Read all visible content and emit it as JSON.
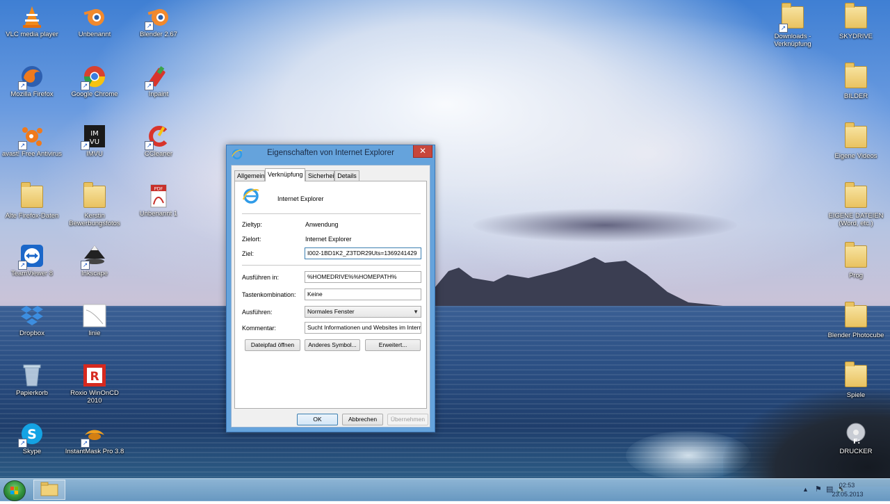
{
  "desktop": {
    "icons_left": [
      {
        "label": "VLC media player",
        "icon": "vlc-cone-icon"
      },
      {
        "label": "Unbenannt",
        "icon": "blender-icon"
      },
      {
        "label": "Blender 2.67",
        "icon": "blender-icon"
      },
      {
        "label": "Mozilla Firefox",
        "icon": "firefox-icon"
      },
      {
        "label": "Google Chrome",
        "icon": "chrome-icon"
      },
      {
        "label": "Inpaint",
        "icon": "inpaint-icon"
      },
      {
        "label": "avast! Free Antivirus",
        "icon": "avast-icon"
      },
      {
        "label": "IMVU",
        "icon": "imvu-icon"
      },
      {
        "label": "CCleaner",
        "icon": "ccleaner-icon"
      },
      {
        "label": "Alte Firefox-Daten",
        "icon": "folder-icon"
      },
      {
        "label": "Kerstin Bewerbungsfotos",
        "icon": "folder-icon"
      },
      {
        "label": "Unbenannt 1",
        "icon": "pdf-icon"
      },
      {
        "label": "TeamViewer 8",
        "icon": "teamviewer-icon"
      },
      {
        "label": "Inkscape",
        "icon": "inkscape-icon"
      },
      {
        "label": "Dropbox",
        "icon": "dropbox-icon"
      },
      {
        "label": "linie",
        "icon": "image-file-icon"
      },
      {
        "label": "Papierkorb",
        "icon": "recycle-bin-icon"
      },
      {
        "label": "Roxio WinOnCD 2010",
        "icon": "roxio-icon"
      },
      {
        "label": "Skype",
        "icon": "skype-icon"
      },
      {
        "label": "InstantMask Pro 3.8",
        "icon": "instantmask-icon"
      }
    ],
    "icons_right": [
      {
        "label": "Downloads - Verknüpfung",
        "icon": "folder-icon"
      },
      {
        "label": "SKYDRIVE",
        "icon": "folder-icon"
      },
      {
        "label": "BILDER",
        "icon": "folder-icon"
      },
      {
        "label": "Eigene Videos",
        "icon": "folder-icon"
      },
      {
        "label": "EIGENE DATEIEN (Word, etc.)",
        "icon": "folder-icon"
      },
      {
        "label": "Prog",
        "icon": "folder-icon"
      },
      {
        "label": "Blender Photocube",
        "icon": "folder-icon"
      },
      {
        "label": "Spiele",
        "icon": "folder-icon"
      },
      {
        "label": "DRUCKER",
        "icon": "printer-icon"
      }
    ]
  },
  "dialog": {
    "title": "Eigenschaften von Internet Explorer",
    "close_label": "✕",
    "tabs": [
      {
        "label": "Allgemein",
        "active": false
      },
      {
        "label": "Verknüpfung",
        "active": true
      },
      {
        "label": "Sicherheit",
        "active": false
      },
      {
        "label": "Details",
        "active": false
      }
    ],
    "app_name": "Internet Explorer",
    "fields": {
      "zieltyp": {
        "label": "Zieltyp:",
        "value": "Anwendung"
      },
      "zielort": {
        "label": "Zielort:",
        "value": "Internet Explorer"
      },
      "ziel": {
        "label": "Ziel:",
        "value": "I002-1BD1K2_Z3TDR29Uts=1369241429"
      },
      "ausfuehren_in": {
        "label": "Ausführen in:",
        "value": "%HOMEDRIVE%%HOMEPATH%"
      },
      "tastenkombination": {
        "label": "Tastenkombination:",
        "value": "Keine"
      },
      "ausfuehren": {
        "label": "Ausführen:",
        "value": "Normales Fenster"
      },
      "kommentar": {
        "label": "Kommentar:",
        "value": "Sucht Informationen und Websites im Intern"
      }
    },
    "buttons": {
      "dateipfad": "Dateipfad öffnen",
      "anderes_symbol": "Anderes Symbol...",
      "erweitert": "Erweitert...",
      "ok": "OK",
      "abbrechen": "Abbrechen",
      "uebernehmen": "Übernehmen"
    }
  },
  "taskbar": {
    "clock_time": "02:53",
    "clock_date": "23.05.2013",
    "tray": {
      "chevron": "▲",
      "network": "network-icon",
      "volume": "volume-icon",
      "flag": "flag-icon"
    }
  },
  "colors": {
    "accent": "#65a3dc",
    "close_red": "#c7463b"
  }
}
